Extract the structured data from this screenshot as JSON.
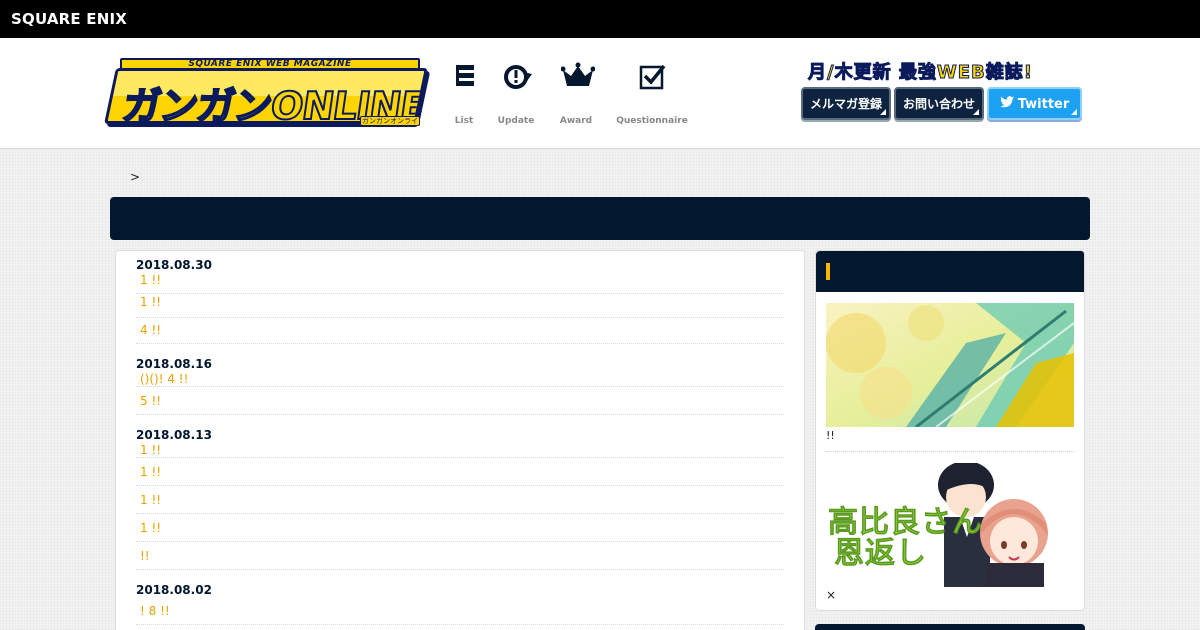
{
  "top_bar": {
    "brand": "SQUARE ENIX"
  },
  "header": {
    "logo": {
      "subtitle": "SQUARE ENIX WEB MAGAZINE",
      "name": "ガンガンONLINE",
      "kana": "ガンガンオンライン"
    },
    "nav": [
      {
        "label": "List",
        "icon": "list-icon"
      },
      {
        "label": "Update",
        "icon": "update-icon"
      },
      {
        "label": "Award",
        "icon": "crown-icon"
      },
      {
        "label": "Questionnaire",
        "icon": "checkbox-icon"
      }
    ],
    "tagline": "月/木更新 最強WEB雑誌!",
    "buttons": {
      "newsletter": "メルマガ登録",
      "contact": "お問い合わせ",
      "twitter": "Twitter"
    }
  },
  "breadcrumb": ">",
  "news": [
    {
      "date": "2018.08.30",
      "entries": [
        " 1 !!",
        " 1 !!",
        " 4 !!"
      ]
    },
    {
      "date": "2018.08.16",
      "entries": [
        "()()! 4 !!",
        " 5 !!"
      ]
    },
    {
      "date": "2018.08.13",
      "entries": [
        " 1 !!",
        " 1 !!",
        " 1 !!",
        " 1 !!",
        " !!"
      ]
    },
    {
      "date": "2018.08.02",
      "entries": [
        "! 8 !!"
      ]
    }
  ],
  "sidebar": {
    "heading_marker": "|",
    "banner1_caption": "!!",
    "banner2_title_line1": "高比良さん",
    "banner2_title_line2": "恩返し",
    "banner2_caption": "×"
  },
  "colors": {
    "navy": "#03172e",
    "accent_orange": "#e6a200",
    "logo_yellow": "#ffd400",
    "twitter_blue": "#1da1f2"
  }
}
